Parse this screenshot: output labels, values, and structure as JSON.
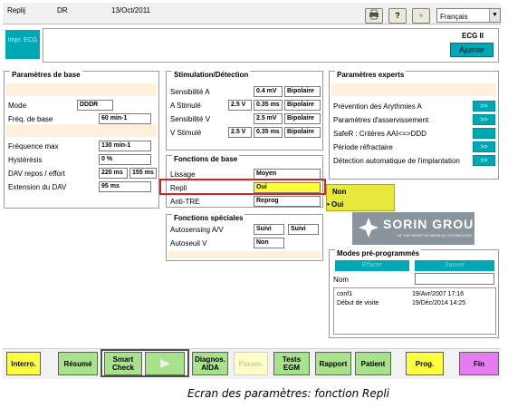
{
  "header": {
    "app": "Replij",
    "user": "DR",
    "date": "13/Oct/2011",
    "language": "Français",
    "print_icon": "printer-icon",
    "help_icon": "question-icon",
    "plus_icon": "plus-icon"
  },
  "toolbar": {
    "impr_ecg": "Impr. ECG",
    "ecg_lead": "ECG II",
    "adjust": "Ajuster"
  },
  "basic_params": {
    "title": "Paramètres de base",
    "rows": [
      {
        "label": "Mode",
        "value": "DDDR"
      },
      {
        "label": "Fréq. de base",
        "value": "60 min-1"
      },
      {
        "label": "Fréquence max",
        "value": "130 min-1"
      },
      {
        "label": "Hystérésis",
        "value": "0 %"
      },
      {
        "label": "DAV repos / effort",
        "value": "220 ms",
        "value2": "155 ms"
      },
      {
        "label": "Extension du DAV",
        "value": "95 ms"
      }
    ]
  },
  "stim_detect": {
    "title": "Stimulation/Détection",
    "rows": [
      {
        "label": "Sensibilité A",
        "v1": "",
        "v2": "0.4 mV",
        "v3": "Bipolaire"
      },
      {
        "label": "A Stimulé",
        "v1": "2.5 V",
        "v2": "0.35 ms",
        "v3": "Bipolaire"
      },
      {
        "label": "Sensibilité V",
        "v1": "",
        "v2": "2.5 mV",
        "v3": "Bipolaire"
      },
      {
        "label": "V Stimulé",
        "v1": "2.5 V",
        "v2": "0.35 ms",
        "v3": "Bipolaire"
      }
    ]
  },
  "base_functions": {
    "title": "Fonctions de base",
    "rows": [
      {
        "label": "Lissage",
        "value": "Moyen"
      },
      {
        "label": "Repli",
        "value": "Oui"
      },
      {
        "label": "Anti-TRE",
        "value": "Reprog"
      }
    ],
    "dropdown_options": [
      "Non",
      "Oui"
    ]
  },
  "special_functions": {
    "title": "Fonctions spéciales",
    "rows": [
      {
        "label": "Autosensing A/V",
        "v1": "Suivi",
        "v2": "Suivi"
      },
      {
        "label": "Autoseuil V",
        "v1": "Non"
      }
    ]
  },
  "expert_params": {
    "title": "Paramètres experts",
    "rows": [
      {
        "label": "Prévention des Arythmies A",
        "button": ">>"
      },
      {
        "label": "Paramètres d'asservissement",
        "button": ">>"
      },
      {
        "label": "SafeR : Critères AAI<=>DDD",
        "button": ""
      },
      {
        "label": "Période réfractaire",
        "button": ">>"
      },
      {
        "label": "Détection automatique de l'implantation",
        "button": ">>"
      }
    ]
  },
  "logo": {
    "name": "SORIN GROUP",
    "tagline": "AT THE HEART OF MEDICAL TECHNOLOGY"
  },
  "preset_modes": {
    "title": "Modes pré-programmés",
    "buttons": [
      "Effacer",
      "Sauver"
    ],
    "name_label": "Nom",
    "items": [
      {
        "name": "conf1",
        "date": "19/Avr/2007 17:16"
      },
      {
        "name": "Début de visite",
        "date": "19/Déc/2014 14:25"
      }
    ]
  },
  "bottom": {
    "interro": "Interro.",
    "resume": "Résumé",
    "smart_check": "Smart Check",
    "play_icon": "play-icon",
    "diagnos": "Diagnos. AIDA",
    "param": "Param.",
    "tests": "Tests EGM",
    "rapport": "Rapport",
    "patient": "Patient",
    "prog": "Prog.",
    "fin": "Fin"
  },
  "caption": "Ecran des paramètres: fonction Repli",
  "colors": {
    "teal": "#00a7b5",
    "yellow": "#ffff40",
    "green": "#a8e28a",
    "pink": "#e77bf0",
    "highlight": "#e02020",
    "dropdown": "#e8e83c"
  }
}
